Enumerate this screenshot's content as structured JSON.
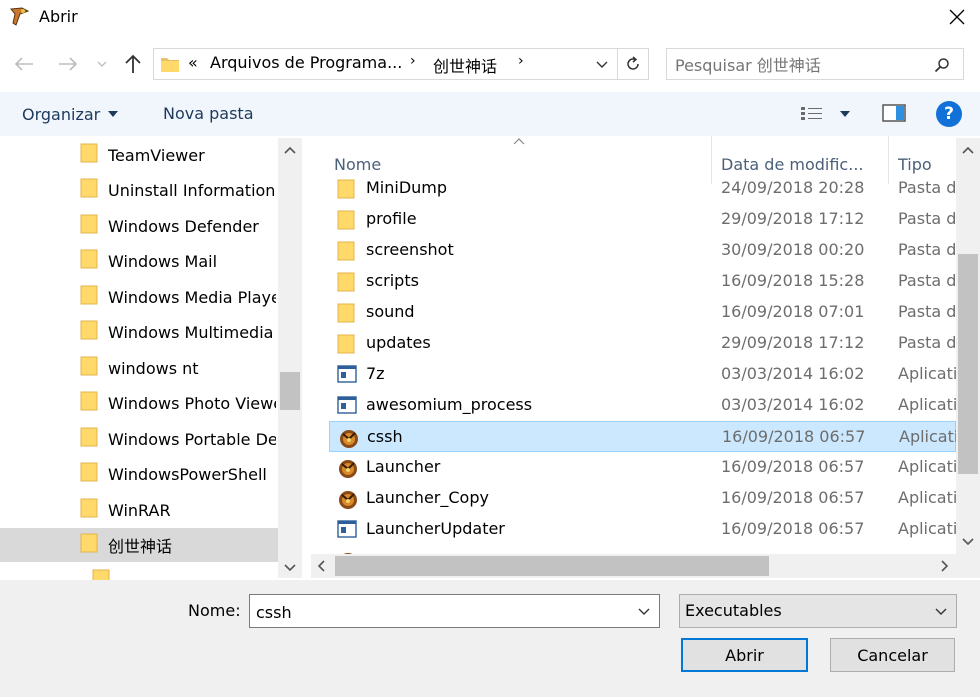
{
  "window": {
    "title": "Abrir",
    "accent": "#0078d7"
  },
  "address": {
    "overflow": "«",
    "crumbs": [
      "Arquivos de Programa...",
      "创世神话"
    ]
  },
  "search": {
    "placeholder": "Pesquisar 创世神话"
  },
  "toolbar": {
    "organize_label": "Organizar",
    "new_folder_label": "Nova pasta",
    "help_label": "?"
  },
  "nav": {
    "items": [
      {
        "label": "TeamViewer"
      },
      {
        "label": "Uninstall Information"
      },
      {
        "label": "Windows Defender"
      },
      {
        "label": "Windows Mail"
      },
      {
        "label": "Windows Media Player"
      },
      {
        "label": "Windows Multimedia Platform"
      },
      {
        "label": "windows nt"
      },
      {
        "label": "Windows Photo Viewer"
      },
      {
        "label": "Windows Portable Devices"
      },
      {
        "label": "WindowsPowerShell"
      },
      {
        "label": "WinRAR"
      },
      {
        "label": "创世神话"
      }
    ]
  },
  "columns": {
    "name": "Nome",
    "date": "Data de modific...",
    "type": "Tipo"
  },
  "files": [
    {
      "name": "MiniDump",
      "date": "24/09/2018 20:28",
      "type": "Pasta de arquivos",
      "icon": "folder-icon"
    },
    {
      "name": "profile",
      "date": "29/09/2018 17:12",
      "type": "Pasta de arquivos",
      "icon": "folder-icon"
    },
    {
      "name": "screenshot",
      "date": "30/09/2018 00:20",
      "type": "Pasta de arquivos",
      "icon": "folder-icon"
    },
    {
      "name": "scripts",
      "date": "16/09/2018 15:28",
      "type": "Pasta de arquivos",
      "icon": "folder-icon"
    },
    {
      "name": "sound",
      "date": "16/09/2018 07:01",
      "type": "Pasta de arquivos",
      "icon": "folder-icon"
    },
    {
      "name": "updates",
      "date": "29/09/2018 17:12",
      "type": "Pasta de arquivos",
      "icon": "folder-icon"
    },
    {
      "name": "7z",
      "date": "03/03/2014 16:02",
      "type": "Aplicativo",
      "icon": "app-window-icon"
    },
    {
      "name": "awesomium_process",
      "date": "03/03/2014 16:02",
      "type": "Aplicativo",
      "icon": "app-window-icon"
    },
    {
      "name": "cssh",
      "date": "16/09/2018 06:57",
      "type": "Aplicativo",
      "icon": "game-app-icon"
    },
    {
      "name": "Launcher",
      "date": "16/09/2018 06:57",
      "type": "Aplicativo",
      "icon": "game-app-icon"
    },
    {
      "name": "Launcher_Copy",
      "date": "16/09/2018 06:57",
      "type": "Aplicativo",
      "icon": "game-app-icon"
    },
    {
      "name": "LauncherUpdater",
      "date": "16/09/2018 06:57",
      "type": "Aplicativo",
      "icon": "app-window-icon"
    }
  ],
  "filename": {
    "label": "Nome:",
    "value": "cssh"
  },
  "filetype": {
    "value": "Executables"
  },
  "buttons": {
    "open": "Abrir",
    "cancel": "Cancelar"
  }
}
